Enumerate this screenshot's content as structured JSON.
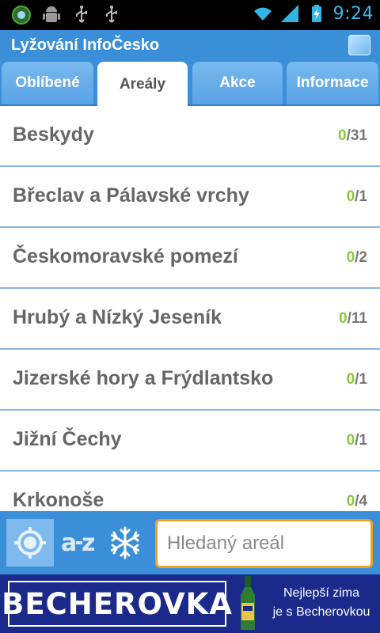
{
  "status_bar": {
    "time": "9:24",
    "clock_color": "#3ab7ea"
  },
  "app": {
    "title": "Lyžování InfoČesko",
    "header_color": "#3b8fd8"
  },
  "tabs": [
    {
      "label": "Oblíbené",
      "active": false
    },
    {
      "label": "Areály",
      "active": true
    },
    {
      "label": "Akce",
      "active": false
    },
    {
      "label": "Informace",
      "active": false
    }
  ],
  "regions": [
    {
      "name": "Beskydy",
      "favorites": "0",
      "total": "/31"
    },
    {
      "name": "Břeclav a Pálavské vrchy",
      "favorites": "0",
      "total": "/1"
    },
    {
      "name": "Českomoravské pomezí",
      "favorites": "0",
      "total": "/2"
    },
    {
      "name": "Hrubý a Nízký Jeseník",
      "favorites": "0",
      "total": "/11"
    },
    {
      "name": "Jizerské hory a Frýdlantsko",
      "favorites": "0",
      "total": "/1"
    },
    {
      "name": "Jižní Čechy",
      "favorites": "0",
      "total": "/1"
    },
    {
      "name": "Krkonoše",
      "favorites": "0",
      "total": "/4"
    }
  ],
  "toolbar": {
    "locate_icon": "crosshair-locate-icon",
    "sort_icon": "az-sort-icon",
    "snow_icon": "snowflake-icon",
    "search_placeholder": "Hledaný areál",
    "search_value": ""
  },
  "ad": {
    "brand": "BECHEROVKA",
    "slogan_line1": "Nejlepší zima",
    "slogan_line2": "je s Becherovkou"
  },
  "colors": {
    "favorite_count": "#8dc63f",
    "search_border": "#f0a022",
    "banner_bg": "#1b2a8a"
  }
}
